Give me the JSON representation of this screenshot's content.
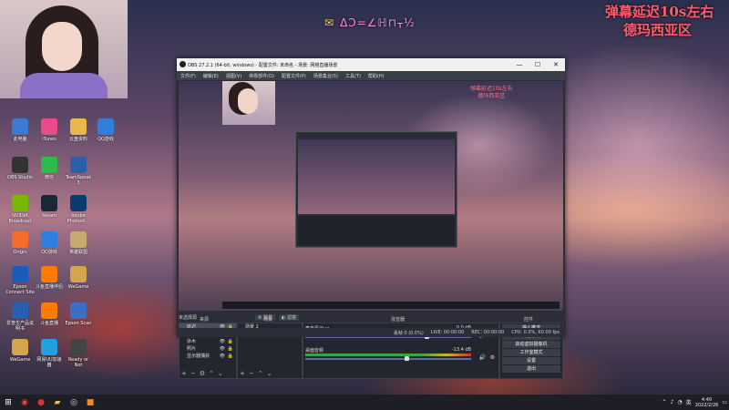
{
  "overlay": {
    "banner_icon": "✉",
    "banner_text": "ΔƆ=∠ℍ⊓ᚁ½",
    "delay_line1": "弹幕延迟10s左右",
    "delay_line2": "德玛西亚区"
  },
  "desktop_icons": [
    {
      "label": "此电脑",
      "icon": "computer-icon",
      "color": "#3a7bd5"
    },
    {
      "label": "iTunes",
      "icon": "itunes-icon",
      "color": "#e94b8a"
    },
    {
      "label": "云盘资料",
      "icon": "folder-icon",
      "color": "#e8b84a"
    },
    {
      "label": "QQ游戏",
      "icon": "qqgame-icon",
      "color": "#2f7fe0"
    },
    {
      "label": "OBS Studio",
      "icon": "obs-icon",
      "color": "#333333"
    },
    {
      "label": "微信",
      "icon": "wechat-icon",
      "color": "#2dbb4e"
    },
    {
      "label": "TeamSpeak 3",
      "icon": "teamspeak-icon",
      "color": "#2b5fa8"
    },
    {
      "label": "NVIDIA Broadcast",
      "icon": "nvidia-icon",
      "color": "#76b900"
    },
    {
      "label": "Steam",
      "icon": "steam-icon",
      "color": "#1b2838"
    },
    {
      "label": "Adobe Photosh...",
      "icon": "photoshop-icon",
      "color": "#0a3c6e"
    },
    {
      "label": "Origin",
      "icon": "origin-icon",
      "color": "#f56c2d"
    },
    {
      "label": "QQ游戏",
      "icon": "qqgame-icon",
      "color": "#2f7fe0"
    },
    {
      "label": "英雄联盟",
      "icon": "lol-icon",
      "color": "#c8aa6e"
    },
    {
      "label": "Epson Connect Site",
      "icon": "epson-icon",
      "color": "#1e5bb8"
    },
    {
      "label": "斗鱼直播伴侣",
      "icon": "douyu-icon",
      "color": "#ff7a00"
    },
    {
      "label": "WeGame",
      "icon": "wegame-icon",
      "color": "#d4a54a"
    },
    {
      "label": "爱普生产品说明书",
      "icon": "manual-icon",
      "color": "#2a5fb0"
    },
    {
      "label": "斗鱼直播",
      "icon": "douyu-icon",
      "color": "#ff7a00"
    },
    {
      "label": "Epson Scan",
      "icon": "scan-icon",
      "color": "#3a6fc4"
    },
    {
      "label": "WeGame",
      "icon": "wegame-icon",
      "color": "#d4a54a"
    },
    {
      "label": "网易UU加速器",
      "icon": "uu-icon",
      "color": "#1fa1e0"
    },
    {
      "label": "Ready or Not",
      "icon": "readyornot-icon",
      "color": "#444444"
    }
  ],
  "obs": {
    "title": "OBS 27.2.1 (64-bit, windows) - 配置文件: 未命名 - 场景: 网络直播场景",
    "window_controls": [
      "—",
      "☐",
      "✕"
    ],
    "menus": [
      "文件(F)",
      "编辑(E)",
      "视图(V)",
      "停靠部件(D)",
      "配置文件(P)",
      "场景集合(S)",
      "工具(T)",
      "帮助(H)"
    ],
    "preview_caption_1": "弹幕延迟10s左右",
    "preview_caption_2": "德玛西亚区",
    "no_source": "未选择源",
    "properties_btn": "属性",
    "filters_btn": "滤镜",
    "docks": {
      "sources_title": "来源",
      "scenes_title": "场景",
      "mixer_title": "混音器",
      "controls_title": "控件"
    },
    "sources": [
      {
        "name": "延迟",
        "selected": true
      },
      {
        "name": "滚动",
        "selected": false
      },
      {
        "name": "杂木",
        "selected": false
      },
      {
        "name": "照片",
        "selected": false
      },
      {
        "name": "显示器捕获",
        "selected": false
      }
    ],
    "scenes": [
      "场景 2"
    ],
    "mixer": [
      {
        "name": "麦克风/Aux",
        "level_db": "0.0 dB",
        "level": 0.72
      },
      {
        "name": "桌面音频",
        "level_db": "-13.4 dB",
        "level": 0.6
      }
    ],
    "controls": [
      "停止推流",
      "开始录制",
      "启动虚拟摄像机",
      "工作室模式",
      "设置",
      "退出"
    ],
    "status": {
      "dropped": "丢帧 0 (0.0%)",
      "live": "LIVE: 00:00:00",
      "rec": "REC: 00:00:00",
      "cpu": "CPU: 0.0%, 60.00 fps"
    }
  },
  "taskbar": {
    "items": [
      {
        "icon": "windows-start-icon",
        "glyph": "⊞",
        "color": "#ffffff"
      },
      {
        "icon": "chrome-icon",
        "glyph": "◉",
        "color": "#e8453c"
      },
      {
        "icon": "netease-icon",
        "glyph": "●",
        "color": "#d33"
      },
      {
        "icon": "file-explorer-icon",
        "glyph": "▰",
        "color": "#f0c040"
      },
      {
        "icon": "obs-icon",
        "glyph": "◎",
        "color": "#ddd"
      },
      {
        "icon": "app-icon",
        "glyph": "■",
        "color": "#f08a24"
      }
    ],
    "time": "4:40",
    "date": "2022/2/26",
    "tray_lang": "英"
  }
}
